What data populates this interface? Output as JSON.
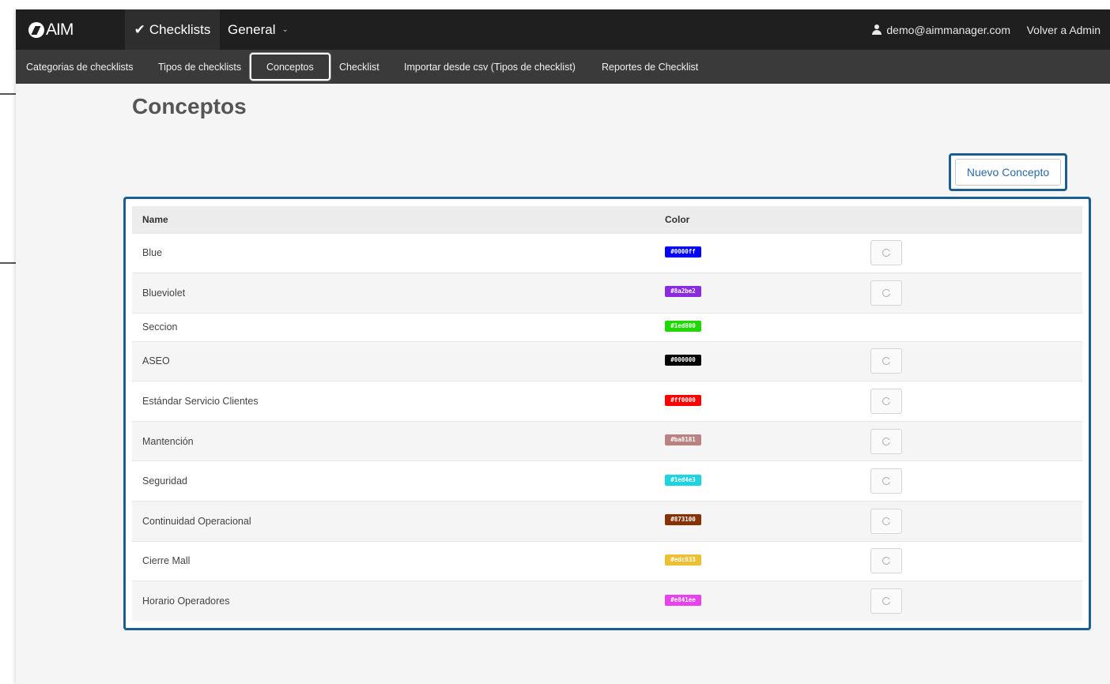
{
  "navbar": {
    "brand": "AIM",
    "checklists_label": "Checklists",
    "general_label": "General",
    "user_email": "demo@aimmanager.com",
    "back_admin_label": "Volver a Admin"
  },
  "subnav": {
    "items": [
      {
        "label": "Categorias de checklists"
      },
      {
        "label": "Tipos de checklists"
      },
      {
        "label": "Conceptos"
      },
      {
        "label": "Checklist"
      },
      {
        "label": "Importar desde csv (Tipos de checklist)"
      },
      {
        "label": "Reportes de Checklist"
      }
    ],
    "active_index": 2
  },
  "page": {
    "title": "Conceptos",
    "new_button_label": "Nuevo Concepto"
  },
  "table": {
    "headers": {
      "name": "Name",
      "color": "Color"
    },
    "rows": [
      {
        "name": "Blue",
        "color_hex": "#0000ff",
        "color_label": "#0000ff",
        "has_action": true
      },
      {
        "name": "Blueviolet",
        "color_hex": "#8a2be2",
        "color_label": "#8a2be2",
        "has_action": true
      },
      {
        "name": "Seccion",
        "color_hex": "#1ed800",
        "color_label": "#1ed800",
        "has_action": false
      },
      {
        "name": "ASEO",
        "color_hex": "#000000",
        "color_label": "#000000",
        "has_action": true
      },
      {
        "name": "Estándar Servicio Clientes",
        "color_hex": "#ff0000",
        "color_label": "#ff0000",
        "has_action": true
      },
      {
        "name": "Mantención",
        "color_hex": "#ba8181",
        "color_label": "#ba8181",
        "has_action": true
      },
      {
        "name": "Seguridad",
        "color_hex": "#1ed4e3",
        "color_label": "#1ed4e3",
        "has_action": true
      },
      {
        "name": "Continuidad Operacional",
        "color_hex": "#873100",
        "color_label": "#873100",
        "has_action": true
      },
      {
        "name": "Cierre Mall",
        "color_hex": "#edc033",
        "color_label": "#edc033",
        "has_action": true
      },
      {
        "name": "Horario Operadores",
        "color_hex": "#e841ee",
        "color_label": "#e841ee",
        "has_action": true
      }
    ]
  },
  "colors": {
    "topbar": "#1f1f1f",
    "subbar": "#3a3a3a",
    "highlight": "#1b5f92",
    "link": "#2a6aa8"
  },
  "icons": {
    "logo": "aim-logo-icon",
    "check": "check-icon",
    "user": "user-icon",
    "chevron": "chevron-down-icon",
    "row_action": "history-icon"
  }
}
